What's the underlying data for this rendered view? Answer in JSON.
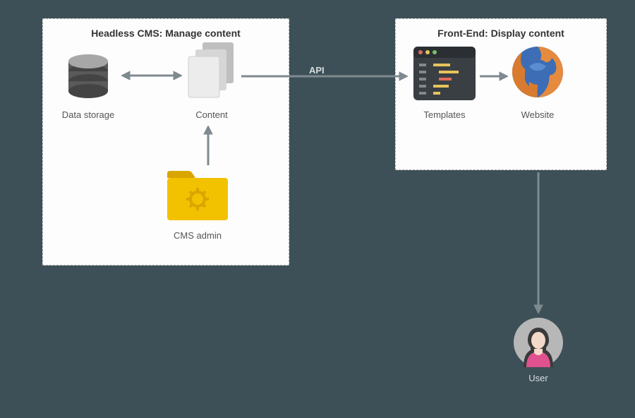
{
  "panel_left_title": "Headless CMS: Manage content",
  "panel_right_title": "Front-End: Display content",
  "data_storage_label": "Data storage",
  "content_label": "Content",
  "cms_admin_label": "CMS admin",
  "templates_label": "Templates",
  "website_label": "Website",
  "user_label": "User",
  "api_label": "API"
}
